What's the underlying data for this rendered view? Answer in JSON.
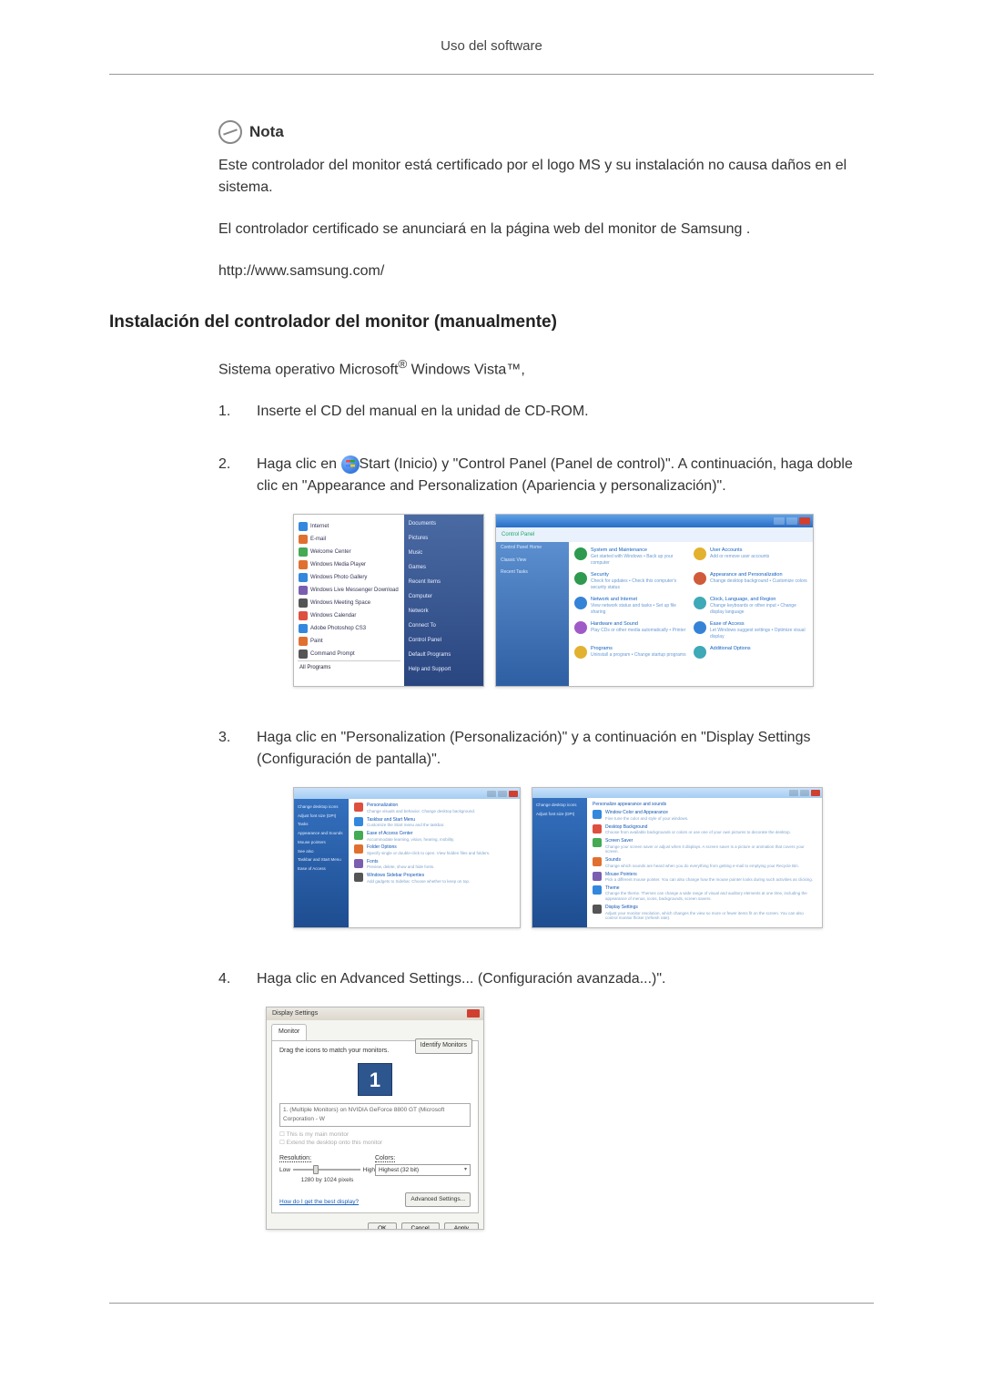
{
  "header": {
    "title": "Uso del software"
  },
  "nota": {
    "label": "Nota",
    "p1": "Este controlador del monitor está certificado por el logo MS y su instalación no causa daños en el sistema.",
    "p2": "El controlador certificado se anunciará en la página web del monitor de Samsung .",
    "url": "http://www.samsung.com/"
  },
  "section": {
    "title": "Instalación del controlador del monitor (manualmente)",
    "os_line_prefix": "Sistema operativo Microsoft",
    "os_line_mid": " Windows Vista",
    "os_line_suffix": ","
  },
  "steps": {
    "s1": {
      "num": "1.",
      "text": "Inserte el CD del manual en la unidad de CD-ROM."
    },
    "s2": {
      "num": "2.",
      "pre": "Haga clic en ",
      "post": "Start (Inicio) y \"Control Panel (Panel de control)\". A continuación, haga doble clic en \"Appearance and Personalization (Apariencia y personalización)\"."
    },
    "s3": {
      "num": "3.",
      "text": "Haga clic en \"Personalization (Personalización)\" y a continuación en \"Display Settings (Configuración de pantalla)\"."
    },
    "s4": {
      "num": "4.",
      "text": "Haga clic en Advanced Settings... (Configuración avanzada...)\"."
    }
  },
  "start_menu": {
    "left": [
      "Internet",
      "E-mail",
      "Welcome Center",
      "Windows Media Player",
      "Windows Photo Gallery",
      "Windows Live Messenger Download",
      "Windows Meeting Space",
      "Windows Calendar",
      "Adobe Photoshop CS3",
      "Paint",
      "Command Prompt"
    ],
    "all_programs": "All Programs",
    "right": [
      "Documents",
      "Pictures",
      "Music",
      "Games",
      "Recent Items",
      "Computer",
      "Network",
      "Connect To",
      "Control Panel",
      "Default Programs",
      "Help and Support"
    ]
  },
  "control_panel": {
    "breadcrumb": "Control Panel",
    "side": [
      "Control Panel Home",
      "Classic View",
      "Recent Tasks"
    ],
    "cats": [
      {
        "t": "System and Maintenance",
        "s": "Get started with Windows • Back up your computer"
      },
      {
        "t": "User Accounts",
        "s": "Add or remove user accounts"
      },
      {
        "t": "Security",
        "s": "Check for updates • Check this computer's security status"
      },
      {
        "t": "Appearance and Personalization",
        "s": "Change desktop background • Customize colors"
      },
      {
        "t": "Network and Internet",
        "s": "View network status and tasks • Set up file sharing"
      },
      {
        "t": "Clock, Language, and Region",
        "s": "Change keyboards or other input • Change display language"
      },
      {
        "t": "Hardware and Sound",
        "s": "Play CDs or other media automatically • Printer"
      },
      {
        "t": "Ease of Access",
        "s": "Let Windows suggest settings • Optimize visual display"
      },
      {
        "t": "Programs",
        "s": "Uninstall a program • Change startup programs"
      },
      {
        "t": "Additional Options",
        "s": ""
      }
    ]
  },
  "personalize": {
    "side": [
      "Change desktop icons",
      "Adjust font size (DPI)",
      "Tasks",
      "Appearance and Sounds",
      "Mouse pointers",
      "See also",
      "Taskbar and Start Menu",
      "Ease of Access"
    ],
    "items": [
      {
        "t": "Personalization",
        "s": "Change visuals and behavior. Change desktop background."
      },
      {
        "t": "Taskbar and Start Menu",
        "s": "Customize the Start menu and the taskbar."
      },
      {
        "t": "Ease of Access Center",
        "s": "Accommodate learning, vision, hearing, mobility."
      },
      {
        "t": "Folder Options",
        "s": "Specify single or double-click to open. View hidden files and folders."
      },
      {
        "t": "Fonts",
        "s": "Preview, delete, show and hide fonts."
      },
      {
        "t": "Windows Sidebar Properties",
        "s": "Add gadgets to Sidebar. Choose whether to keep on top."
      }
    ]
  },
  "personalize2": {
    "heading": "Personalize appearance and sounds",
    "items": [
      {
        "t": "Window Color and Appearance",
        "s": "Fine tune the color and style of your windows."
      },
      {
        "t": "Desktop Background",
        "s": "Choose from available backgrounds or colors or use one of your own pictures to decorate the desktop."
      },
      {
        "t": "Screen Saver",
        "s": "Change your screen saver or adjust when it displays. A screen saver is a picture or animation that covers your screen."
      },
      {
        "t": "Sounds",
        "s": "Change which sounds are heard when you do everything from getting e-mail to emptying your Recycle Bin."
      },
      {
        "t": "Mouse Pointers",
        "s": "Pick a different mouse pointer. You can also change how the mouse pointer looks during such activities as clicking."
      },
      {
        "t": "Theme",
        "s": "Change the theme. Themes can change a wide range of visual and auditory elements at one time, including the appearance of menus, icons, backgrounds, screen savers."
      },
      {
        "t": "Display Settings",
        "s": "Adjust your monitor resolution, which changes the view so more or fewer items fit on the screen. You can also control monitor flicker (refresh rate)."
      }
    ]
  },
  "display_settings": {
    "title": "Display Settings",
    "tab": "Monitor",
    "hint": "Drag the icons to match your monitors.",
    "identify": "Identify Monitors",
    "monitor_num": "1",
    "dropdown": "1. (Multiple Monitors) on NVIDIA GeForce 8800 GT (Microsoft Corporation - W",
    "chk1": "This is my main monitor",
    "chk2": "Extend the desktop onto this monitor",
    "resolution_label": "Resolution:",
    "lo": "Low",
    "hi": "High",
    "res_text": "1280 by 1024 pixels",
    "colors_label": "Colors:",
    "colors_value": "Highest (32 bit)",
    "link": "How do I get the best display?",
    "adv": "Advanced Settings...",
    "ok": "OK",
    "cancel": "Cancel",
    "apply": "Apply"
  }
}
